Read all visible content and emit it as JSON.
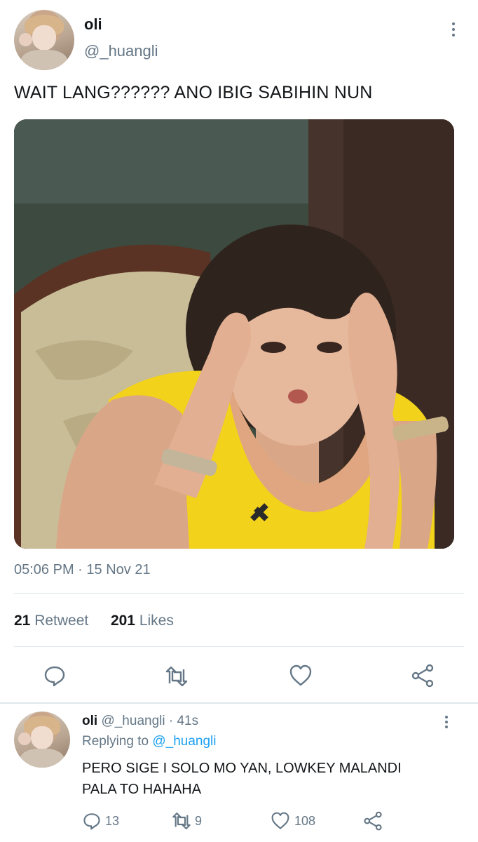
{
  "tweet": {
    "display_name": "oli",
    "handle": "@_huangli",
    "text": "WAIT LANG?????? ANO IBIG SABIHIN NUN",
    "time": "05:06 PM",
    "separator": " · ",
    "date": "15 Nov 21",
    "retweet_count": "21",
    "retweet_label": "Retweet",
    "like_count": "201",
    "like_label": "Likes",
    "icons": [
      "more-vertical-icon",
      "reply-icon",
      "retweet-icon",
      "like-icon",
      "share-icon"
    ]
  },
  "reply": {
    "display_name": "oli",
    "handle": "@_huangli",
    "time": "· 41s",
    "replying_prefix": "Replying to",
    "replying_to": "@_huangli",
    "text_line1": "PERO SIGE I SOLO MO YAN, LOWKEY MALANDI",
    "text_line2": "PALA TO HAHAHA",
    "reply_count": "13",
    "retweet_count": "9",
    "like_count": "108"
  },
  "colors": {
    "accent": "#1da1f2",
    "secondary_text": "#657786",
    "divider": "#e1e8ed",
    "photo_top_yellow": "#f2d21a"
  }
}
